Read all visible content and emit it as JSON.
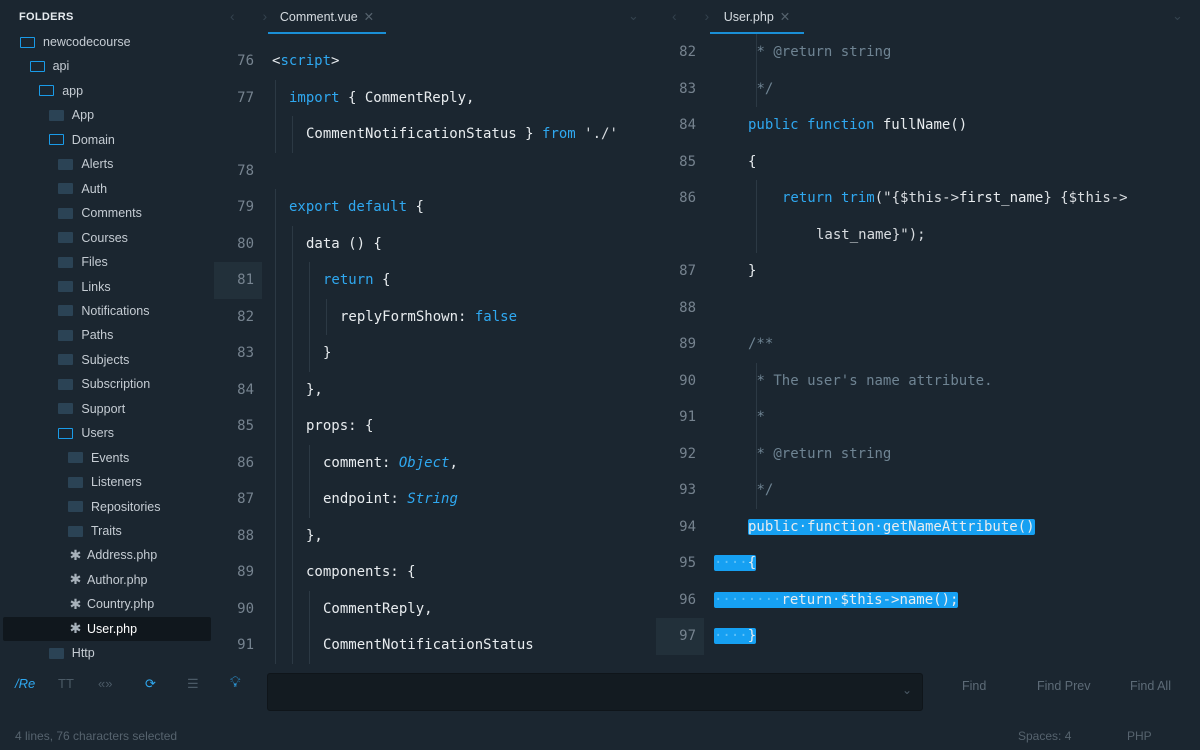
{
  "sidebar": {
    "title": "FOLDERS",
    "items": [
      {
        "label": "newcodecourse",
        "icon": "open",
        "level": 0
      },
      {
        "label": "api",
        "icon": "open",
        "level": 1
      },
      {
        "label": "app",
        "icon": "open",
        "level": 2
      },
      {
        "label": "App",
        "icon": "closed",
        "level": 3
      },
      {
        "label": "Domain",
        "icon": "open",
        "level": 3
      },
      {
        "label": "Alerts",
        "icon": "closed",
        "level": 4
      },
      {
        "label": "Auth",
        "icon": "closed",
        "level": 4
      },
      {
        "label": "Comments",
        "icon": "closed",
        "level": 4
      },
      {
        "label": "Courses",
        "icon": "closed",
        "level": 4
      },
      {
        "label": "Files",
        "icon": "closed",
        "level": 4
      },
      {
        "label": "Links",
        "icon": "closed",
        "level": 4
      },
      {
        "label": "Notifications",
        "icon": "closed",
        "level": 4
      },
      {
        "label": "Paths",
        "icon": "closed",
        "level": 4
      },
      {
        "label": "Subjects",
        "icon": "closed",
        "level": 4
      },
      {
        "label": "Subscription",
        "icon": "closed",
        "level": 4
      },
      {
        "label": "Support",
        "icon": "closed",
        "level": 4
      },
      {
        "label": "Users",
        "icon": "open",
        "level": 4
      },
      {
        "label": "Events",
        "icon": "closed",
        "level": 5
      },
      {
        "label": "Listeners",
        "icon": "closed",
        "level": 5
      },
      {
        "label": "Repositories",
        "icon": "closed",
        "level": 5
      },
      {
        "label": "Traits",
        "icon": "closed",
        "level": 5
      },
      {
        "label": "Address.php",
        "icon": "file",
        "level": 5
      },
      {
        "label": "Author.php",
        "icon": "file",
        "level": 5
      },
      {
        "label": "Country.php",
        "icon": "file",
        "level": 5
      },
      {
        "label": "User.php",
        "icon": "file",
        "level": 5,
        "selected": true
      },
      {
        "label": "Http",
        "icon": "closed",
        "level": 3
      }
    ]
  },
  "left": {
    "tab": "Comment.vue",
    "current_line": "81",
    "rows": [
      {
        "n": "76",
        "ind": 0,
        "t": [
          [
            "p",
            "<"
          ],
          [
            "k",
            "script"
          ],
          [
            "p",
            ">"
          ]
        ]
      },
      {
        "n": "77",
        "ind": 1,
        "t": [
          [
            "k",
            "import"
          ],
          [
            "p",
            " { CommentReply,"
          ]
        ]
      },
      {
        "n": "",
        "ind": 2,
        "t": [
          [
            "p",
            "CommentNotificationStatus } "
          ],
          [
            "k",
            "from"
          ],
          [
            "s",
            " './'"
          ]
        ]
      },
      {
        "n": "78",
        "ind": 0,
        "t": []
      },
      {
        "n": "79",
        "ind": 1,
        "t": [
          [
            "k",
            "export default"
          ],
          [
            "p",
            " {"
          ]
        ]
      },
      {
        "n": "80",
        "ind": 2,
        "t": [
          [
            "p",
            "data () {"
          ]
        ]
      },
      {
        "n": "81",
        "ind": 3,
        "t": [
          [
            "k",
            "return"
          ],
          [
            "p",
            " {"
          ]
        ]
      },
      {
        "n": "82",
        "ind": 4,
        "t": [
          [
            "p",
            "replyFormShown: "
          ],
          [
            "k",
            "false"
          ]
        ]
      },
      {
        "n": "83",
        "ind": 3,
        "t": [
          [
            "p",
            "}"
          ]
        ]
      },
      {
        "n": "84",
        "ind": 2,
        "t": [
          [
            "p",
            "},"
          ]
        ]
      },
      {
        "n": "85",
        "ind": 2,
        "t": [
          [
            "p",
            "props: {"
          ]
        ]
      },
      {
        "n": "86",
        "ind": 3,
        "t": [
          [
            "p",
            "comment: "
          ],
          [
            "i",
            "Object"
          ],
          [
            "p",
            ","
          ]
        ]
      },
      {
        "n": "87",
        "ind": 3,
        "t": [
          [
            "p",
            "endpoint: "
          ],
          [
            "i",
            "String"
          ]
        ]
      },
      {
        "n": "88",
        "ind": 2,
        "t": [
          [
            "p",
            "},"
          ]
        ]
      },
      {
        "n": "89",
        "ind": 2,
        "t": [
          [
            "p",
            "components: {"
          ]
        ]
      },
      {
        "n": "90",
        "ind": 3,
        "t": [
          [
            "p",
            "CommentReply,"
          ]
        ]
      },
      {
        "n": "91",
        "ind": 3,
        "t": [
          [
            "p",
            "CommentNotificationStatus"
          ]
        ]
      }
    ]
  },
  "right": {
    "tab": "User.php",
    "current_line": "97",
    "rows": [
      {
        "n": "82",
        "ind": 2.5,
        "t": [
          [
            "c",
            "* @return string"
          ]
        ]
      },
      {
        "n": "83",
        "ind": 2.5,
        "t": [
          [
            "c",
            "*/"
          ]
        ]
      },
      {
        "n": "84",
        "ind": 2,
        "t": [
          [
            "k",
            "public function"
          ],
          [
            "p",
            " fullName()"
          ]
        ]
      },
      {
        "n": "85",
        "ind": 2,
        "t": [
          [
            "p",
            "{"
          ]
        ]
      },
      {
        "n": "86",
        "ind": 4,
        "t": [
          [
            "k",
            "return"
          ],
          [
            "k",
            " trim"
          ],
          [
            "s",
            "(\"{$this->"
          ],
          [
            "p",
            "first_name"
          ],
          [
            "s",
            "} {$this->"
          ]
        ]
      },
      {
        "n": "",
        "ind": 6,
        "t": [
          [
            "s",
            "last_name}\");"
          ]
        ]
      },
      {
        "n": "87",
        "ind": 2,
        "t": [
          [
            "p",
            "}"
          ]
        ]
      },
      {
        "n": "88",
        "ind": 0,
        "t": []
      },
      {
        "n": "89",
        "ind": 2,
        "t": [
          [
            "c",
            "/**"
          ]
        ]
      },
      {
        "n": "90",
        "ind": 2.5,
        "t": [
          [
            "c",
            "* The user's name attribute."
          ]
        ]
      },
      {
        "n": "91",
        "ind": 2.5,
        "t": [
          [
            "c",
            "*"
          ]
        ]
      },
      {
        "n": "92",
        "ind": 2.5,
        "t": [
          [
            "c",
            "* @return string"
          ]
        ]
      },
      {
        "n": "93",
        "ind": 2.5,
        "t": [
          [
            "c",
            "*/"
          ]
        ]
      },
      {
        "n": "94",
        "ind": 2,
        "sel": true,
        "t": [
          [
            "p",
            "public·function·getNameAttribute()"
          ]
        ]
      },
      {
        "n": "95",
        "ind": 0,
        "sel": true,
        "t": [
          [
            "d",
            "····"
          ],
          [
            "p",
            "{"
          ]
        ]
      },
      {
        "n": "96",
        "ind": 0,
        "sel": true,
        "t": [
          [
            "d",
            "········"
          ],
          [
            "p",
            "return·$this->name();"
          ]
        ]
      },
      {
        "n": "97",
        "ind": 0,
        "sel": true,
        "t": [
          [
            "d",
            "····"
          ],
          [
            "p",
            "}"
          ]
        ]
      }
    ]
  },
  "findbar": {
    "regex": "/Re",
    "case": "TT",
    "word": "«»",
    "wrap": "wrap-icon",
    "sel": "in-selection-icon",
    "highlight": "lightbulb-icon",
    "find_value": "",
    "find": "Find",
    "find_prev": "Find Prev",
    "find_all": "Find All"
  },
  "status": {
    "selection": "4 lines, 76 characters selected",
    "spaces": "Spaces: 4",
    "syntax": "PHP"
  },
  "colors": {
    "accent": "#16a0f2",
    "background": "#1b2630"
  }
}
